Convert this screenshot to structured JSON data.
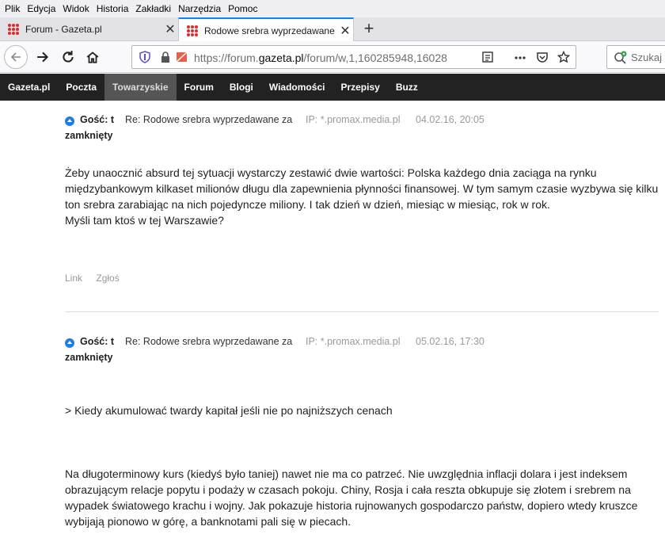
{
  "menu": [
    "Plik",
    "Edycja",
    "Widok",
    "Historia",
    "Zakładki",
    "Narzędzia",
    "Pomoc"
  ],
  "tabs": [
    {
      "title": "Forum - Gazeta.pl",
      "active": false
    },
    {
      "title": "Rodowe srebra wyprzedawane",
      "active": true
    }
  ],
  "address": {
    "prefix": "https://forum.",
    "domain": "gazeta.pl",
    "suffix": "/forum/w,1,160285948,16028"
  },
  "search": {
    "placeholder": "Szukaj"
  },
  "sitenav": [
    "Gazeta.pl",
    "Poczta",
    "Towarzyskie",
    "Forum",
    "Blogi",
    "Wiadomości",
    "Przepisy",
    "Buzz"
  ],
  "sitenav_active": "Towarzyskie",
  "posts": [
    {
      "author": "Gość: t",
      "subject": "Re: Rodowe srebra wyprzedawane za",
      "status": "zamknięty",
      "ip": "IP: *.promax.media.pl",
      "date": "04.02.16, 20:05",
      "body": [
        "Żeby unaocznić absurd tej sytuacji wystarczy zestawić dwie wartości: Polska każdego dnia zaciąga na rynku międzybankowym kilkaset milionów długu dla zapewnienia płynności finansowej. W tym samym czasie wyzbywa się kilku ton srebra zarabiając na nich pojedyncze miliony. I tak dzień w dzień, miesiąc w miesiąc, rok w rok.",
        "Myśli tam ktoś w tej Warszawie?"
      ],
      "actions": [
        "Link",
        "Zgłoś"
      ]
    },
    {
      "author": "Gość: t",
      "subject": "Re: Rodowe srebra wyprzedawane za",
      "status": "zamknięty",
      "ip": "IP: *.promax.media.pl",
      "date": "05.02.16, 17:30",
      "quote": "> Kiedy akumulować twardy kapitał jeśli nie po najniższych cenach",
      "body": [
        "Na długoterminowy kurs (kiedyś było taniej) nawet nie ma co patrzeć. Nie uwzględnia inflacji dolara i jest indeksem obrazującym relacje popytu i podaży w czasach pokoju. Chiny, Rosja i cała reszta obkupuje się złotem i srebrem na wypadek światowego krachu i wojny. Jak pokazuje historia rujnowanych gospodarczo państw, dopiero wtedy kruszce wybijają pionowo w górę, a banknotami pali się w piecach."
      ]
    }
  ],
  "colors": {
    "accent": "#0a84ff",
    "sitenav_bg": "#222222",
    "post_bullet": "#1f7de0"
  }
}
